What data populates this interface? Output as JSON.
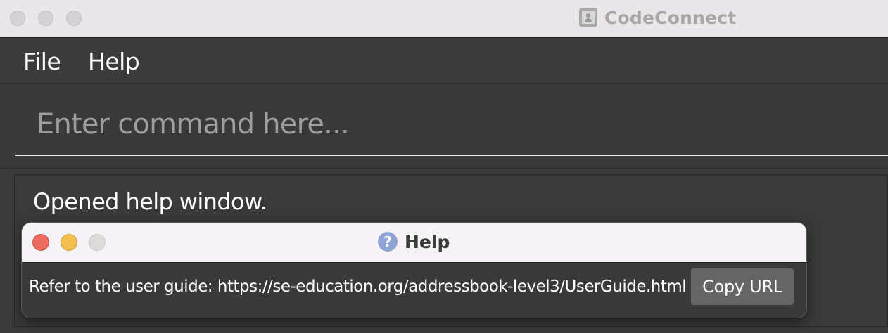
{
  "window": {
    "title": "CodeConnect",
    "app_icon": "contact-card-icon"
  },
  "menu": {
    "items": [
      {
        "label": "File"
      },
      {
        "label": "Help"
      }
    ]
  },
  "command_box": {
    "placeholder": "Enter command here..."
  },
  "result_display": {
    "text": "Opened help window."
  },
  "help_window": {
    "title": "Help",
    "icon": "question-mark-icon",
    "message": "Refer to the user guide: https://se-education.org/addressbook-level3/UserGuide.html",
    "copy_button_label": "Copy URL"
  },
  "colors": {
    "background": "#3b3b3b",
    "titlebar": "#ebe6ea",
    "help_titlebar": "#f6f3f6",
    "button": "#656565",
    "close": "#ec6a5e",
    "minimize": "#f4bf4f",
    "zoom_inactive": "#dcdadb"
  }
}
